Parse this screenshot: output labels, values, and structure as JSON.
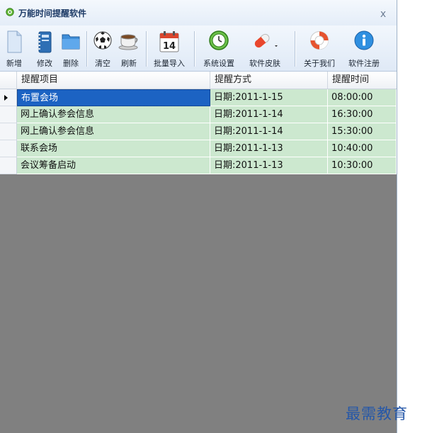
{
  "window": {
    "title": "万能时间提醒软件",
    "close_glyph": "x"
  },
  "toolbar": {
    "items": [
      {
        "label": "新增",
        "icon": "new-document-icon"
      },
      {
        "label": "修改",
        "icon": "notebook-edit-icon"
      },
      {
        "label": "删除",
        "icon": "folder-delete-icon"
      },
      {
        "label": "清空",
        "icon": "soccer-ball-icon"
      },
      {
        "label": "刷新",
        "icon": "coffee-cup-icon"
      },
      {
        "label": "批量导入",
        "icon": "calendar-icon"
      },
      {
        "label": "系统设置",
        "icon": "clock-settings-icon"
      },
      {
        "label": "软件皮肤",
        "icon": "pill-skin-icon"
      },
      {
        "label": "关于我们",
        "icon": "lifebuoy-icon"
      },
      {
        "label": "软件注册",
        "icon": "info-icon"
      }
    ],
    "calendar_day": "14"
  },
  "grid": {
    "columns": [
      "提醒项目",
      "提醒方式",
      "提醒时间"
    ],
    "rows": [
      {
        "item": "布置会场",
        "method": "日期:2011-1-15",
        "time": "08:00:00",
        "selected": true
      },
      {
        "item": "网上确认参会信息",
        "method": "日期:2011-1-14",
        "time": "16:30:00"
      },
      {
        "item": "网上确认参会信息",
        "method": "日期:2011-1-14",
        "time": "15:30:00"
      },
      {
        "item": "联系会场",
        "method": "日期:2011-1-13",
        "time": "10:40:00"
      },
      {
        "item": "会议筹备启动",
        "method": "日期:2011-1-13",
        "time": "10:30:00"
      }
    ]
  },
  "watermark": "最需教育",
  "colors": {
    "row_background": "#cce8cf",
    "selected_row": "#1c63c3",
    "empty_area": "#808080",
    "watermark": "#2557a8"
  }
}
